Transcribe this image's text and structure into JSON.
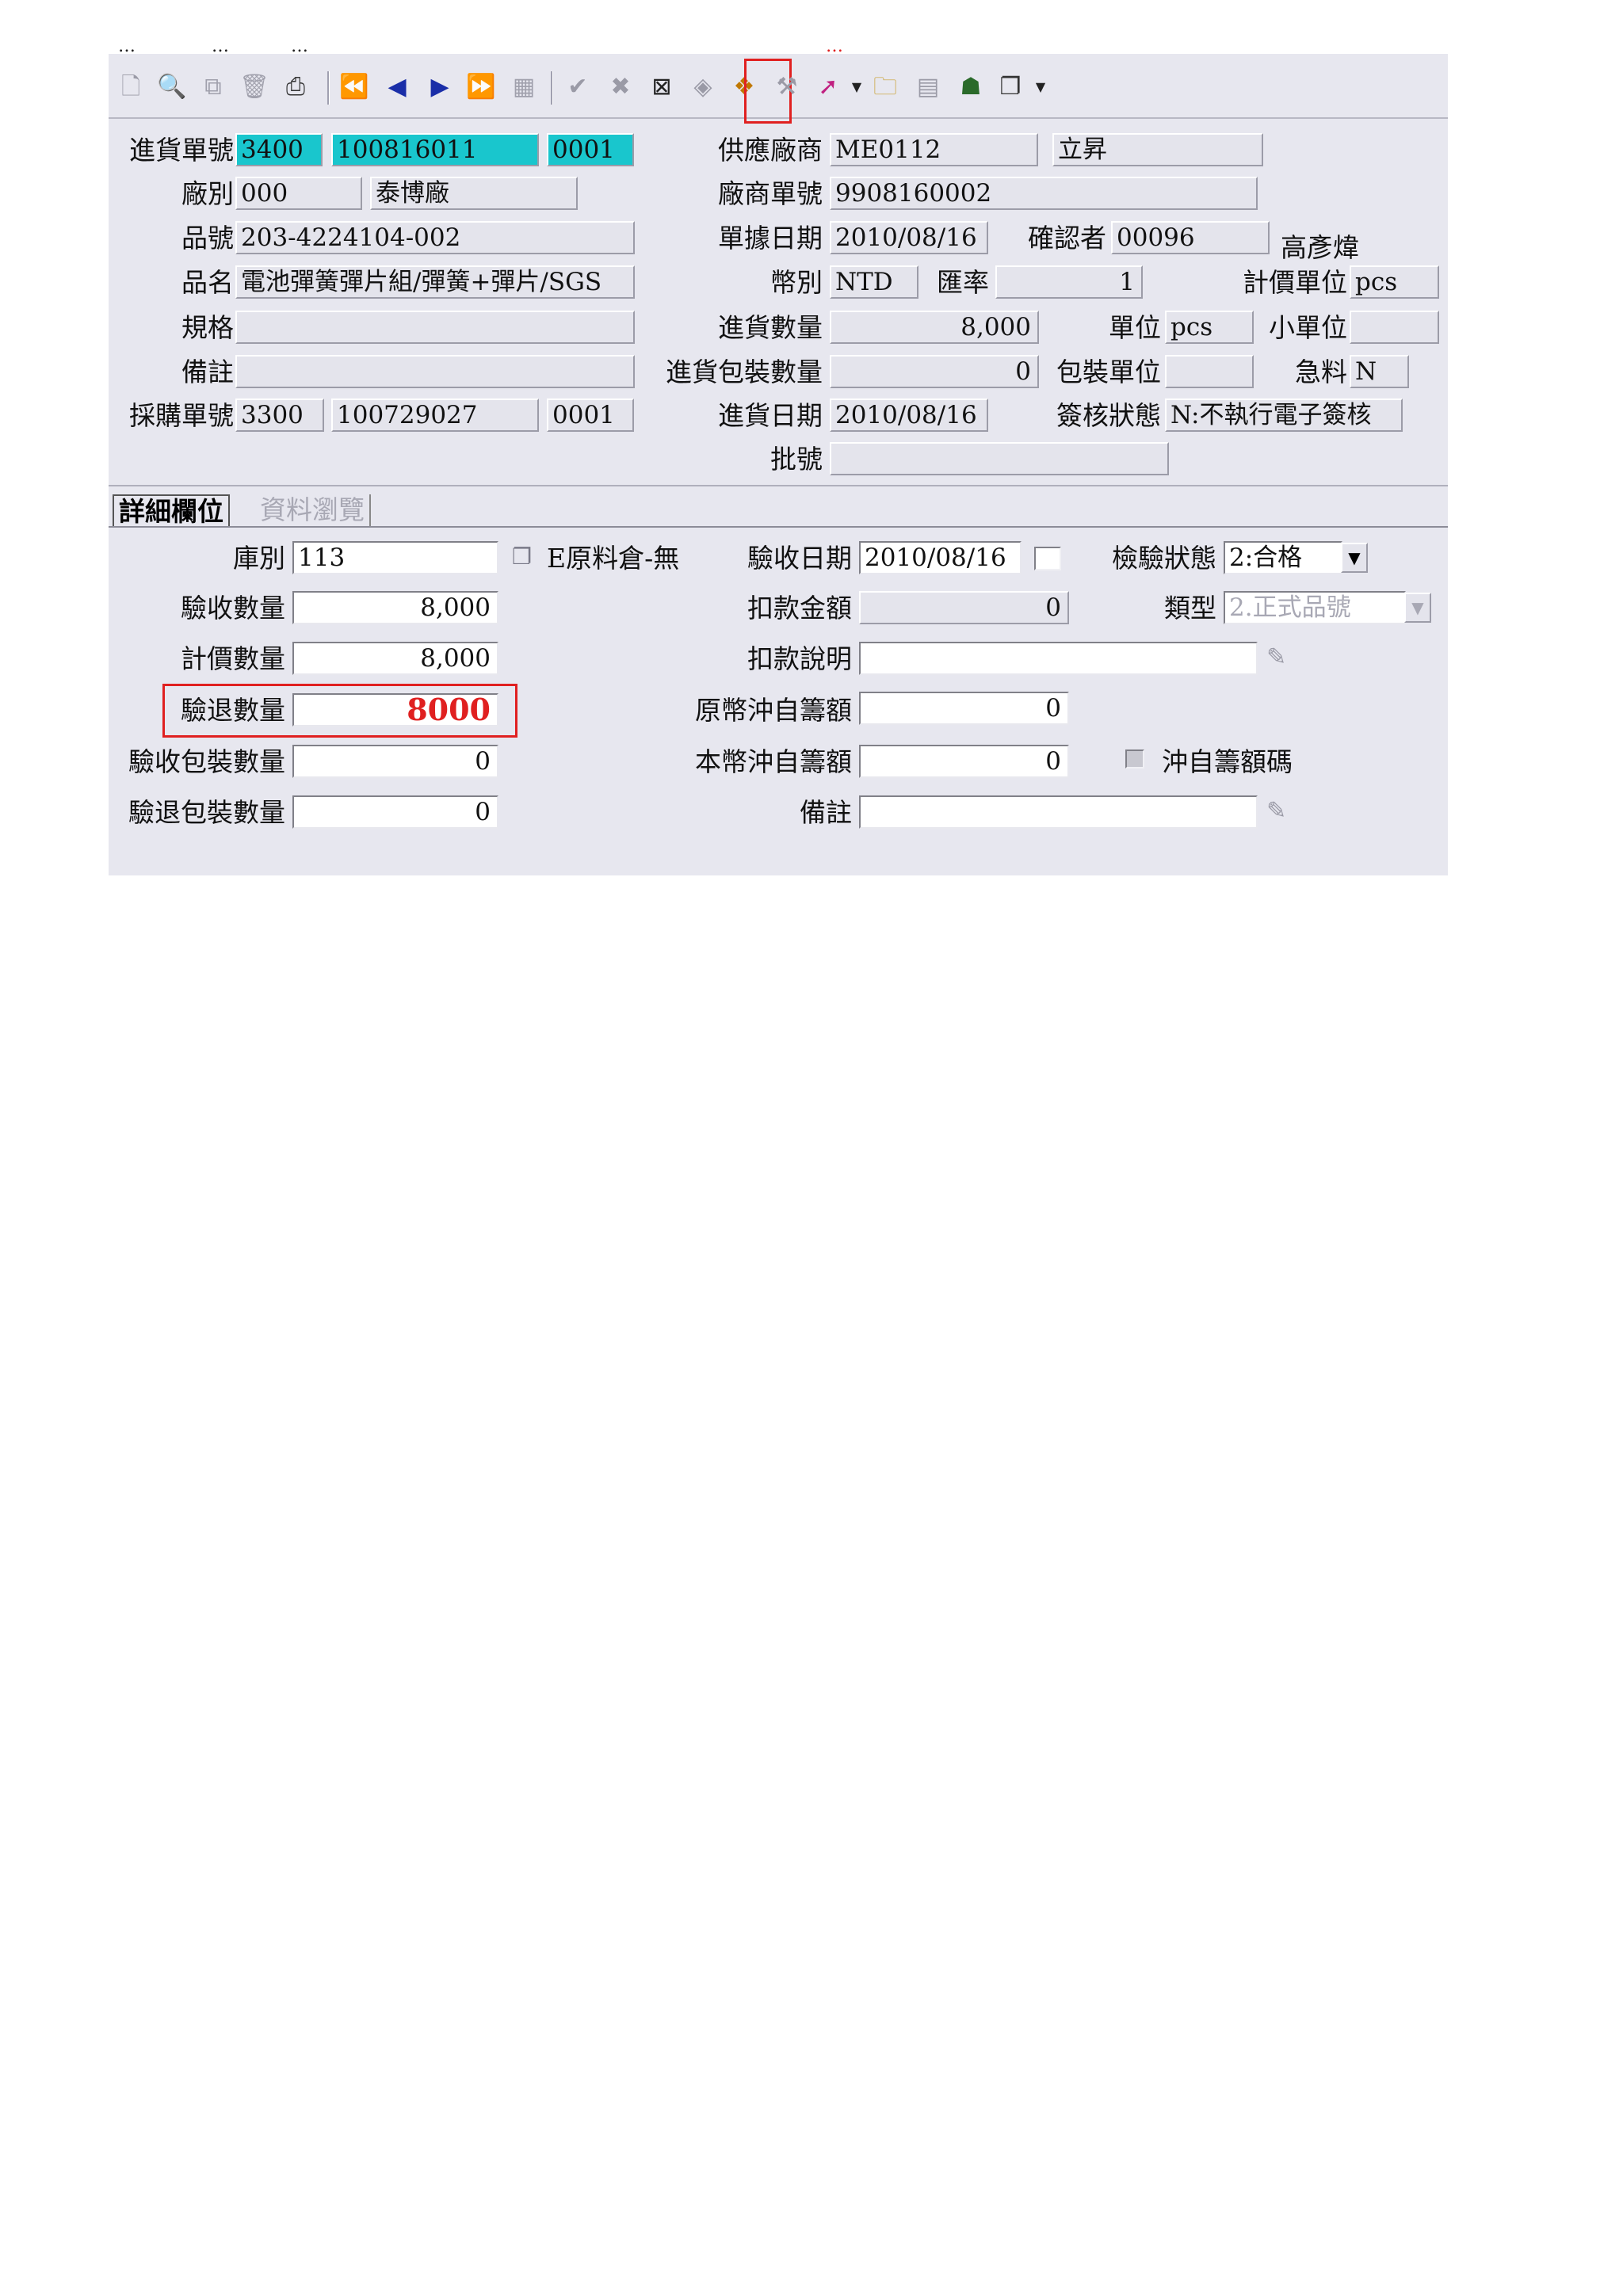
{
  "top_strip": {
    "menu_fragments": [
      "…",
      "…",
      "…"
    ],
    "red_note": "…"
  },
  "toolbar": {
    "icons": [
      "new-document-icon",
      "print-preview-icon",
      "copy-icon",
      "delete-icon",
      "print-icon",
      "first-record-icon",
      "previous-record-icon",
      "next-record-icon",
      "last-record-icon",
      "query-icon",
      "confirm-icon",
      "cancel-icon",
      "export-icon",
      "erase-icon",
      "return-goods-icon",
      "tools-icon",
      "transfer-icon",
      "folder-icon",
      "grid-icon",
      "user-icon",
      "window-icon"
    ],
    "highlighted_icon": "return-goods-icon",
    "highlight_color": "#e02020"
  },
  "header": {
    "receipt_no_label": "進貨單號",
    "receipt_no_type": "3400",
    "receipt_no": "100816011",
    "receipt_no_seq": "0001",
    "plant_label": "廠別",
    "plant_code": "000",
    "plant_name": "泰博廠",
    "part_no_label": "品號",
    "part_no": "203-4224104-002",
    "part_name_label": "品名",
    "part_name": "電池彈簧彈片組/彈簧+彈片/SGS",
    "spec_label": "規格",
    "spec": "",
    "remark_label": "備註",
    "remark": "",
    "po_no_label": "採購單號",
    "po_no_type": "3300",
    "po_no": "100729027",
    "po_no_seq": "0001",
    "supplier_label": "供應廠商",
    "supplier_code": "ME0112",
    "supplier_name": "立昇",
    "vendor_doc_label": "廠商單號",
    "vendor_doc_no": "9908160002",
    "doc_date_label": "單據日期",
    "doc_date": "2010/08/16",
    "confirmer_label": "確認者",
    "confirmer_code": "00096",
    "confirmer_name": "高彥煒",
    "currency_label": "幣別",
    "currency": "NTD",
    "rate_label": "匯率",
    "rate": "1",
    "price_unit_label": "計價單位",
    "price_unit": "pcs",
    "receipt_qty_label": "進貨數量",
    "receipt_qty": "8,000",
    "unit_label": "單位",
    "unit": "pcs",
    "small_unit_label": "小單位",
    "small_unit": "",
    "pack_qty_label": "進貨包裝數量",
    "pack_qty": "0",
    "pack_unit_label": "包裝單位",
    "pack_unit": "",
    "urgent_label": "急料",
    "urgent": "N",
    "receipt_date_label": "進貨日期",
    "receipt_date": "2010/08/16",
    "approval_label": "簽核狀態",
    "approval": "N:不執行電子簽核",
    "lot_label": "批號",
    "lot": ""
  },
  "tabs": [
    {
      "label": "詳細欄位",
      "active": true
    },
    {
      "label": "資料瀏覽",
      "active": false
    }
  ],
  "detail": {
    "warehouse_label": "庫別",
    "warehouse": "113",
    "warehouse_desc": "E原料倉-無",
    "accept_qty_label": "驗收數量",
    "accept_qty": "8,000",
    "price_qty_label": "計價數量",
    "price_qty": "8,000",
    "return_qty_label": "驗退數量",
    "return_qty": "8000",
    "return_qty_color": "#e02020",
    "accept_pack_label": "驗收包裝數量",
    "accept_pack": "0",
    "return_pack_label": "驗退包裝數量",
    "return_pack": "0",
    "accept_date_label": "驗收日期",
    "accept_date": "2010/08/16",
    "deduct_amt_label": "扣款金額",
    "deduct_amt": "0",
    "deduct_desc_label": "扣款說明",
    "deduct_desc": "",
    "orig_offset_label": "原幣沖自籌額",
    "orig_offset": "0",
    "local_offset_label": "本幣沖自籌額",
    "local_offset": "0",
    "remark_label": "備註",
    "remark": "",
    "inspection_label": "檢驗狀態",
    "inspection": "2:合格",
    "type_label": "類型",
    "type": "2.正式品號",
    "self_fund_checkbox_label": "沖自籌額碼"
  }
}
